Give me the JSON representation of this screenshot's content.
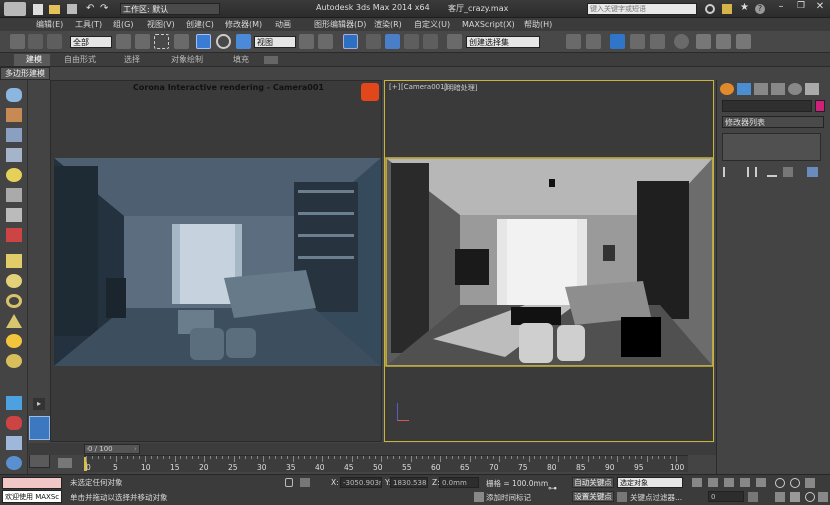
{
  "title_bar": {
    "workspace_label": "工作区: 默认",
    "app_title": "Autodesk 3ds Max  2014 x64",
    "file_title": "客厅_crazy.max",
    "search_placeholder": "键入关键字或短语"
  },
  "menu": [
    "编辑(E)",
    "工具(T)",
    "组(G)",
    "视图(V)",
    "创建(C)",
    "修改器(M)",
    "动画",
    "图形编辑器(D)",
    "渲染(R)",
    "自定义(U)",
    "MAXScript(X)",
    "帮助(H)"
  ],
  "toolbar": {
    "selection_filter": "全部",
    "ref_coord": "视图",
    "named_selection": "创建选择集"
  },
  "ribbon": {
    "tabs": [
      "建模",
      "自由形式",
      "选择",
      "对象绘制",
      "填充"
    ],
    "active_tab": "建模",
    "sub_label": "多边形建模"
  },
  "viewport_left": {
    "title": "Corona Interactive rendering - Camera001"
  },
  "viewport_right": {
    "label_plus": "[+]",
    "label_camera": "[Camera001]",
    "label_shading": "[明暗处理]"
  },
  "command_panel": {
    "modifier_list": "修改器列表",
    "color_swatch": "#d0207a"
  },
  "timeline": {
    "frame_counter": "0 / 100",
    "ticks": [
      "0",
      "5",
      "10",
      "15",
      "20",
      "25",
      "30",
      "35",
      "40",
      "45",
      "50",
      "55",
      "60",
      "65",
      "70",
      "75",
      "80",
      "85",
      "90",
      "95",
      "100"
    ]
  },
  "status": {
    "welcome": "欢迎使用 MAXSc",
    "line1": "未选定任何对象",
    "line2": "单击并拖动以选择并移动对象",
    "x_label": "X:",
    "x_value": "-3050.903r",
    "y_label": "Y:",
    "y_value": "1830.538r",
    "z_label": "Z:",
    "z_value": "0.0mm",
    "grid": "栅格 = 100.0mm",
    "add_time_tag": "添加时间标记",
    "auto_key": "自动关键点",
    "set_key": "设置关键点",
    "selected_dropdown": "选定对象",
    "key_filter": "关键点过滤器...",
    "frame_value": "0"
  }
}
